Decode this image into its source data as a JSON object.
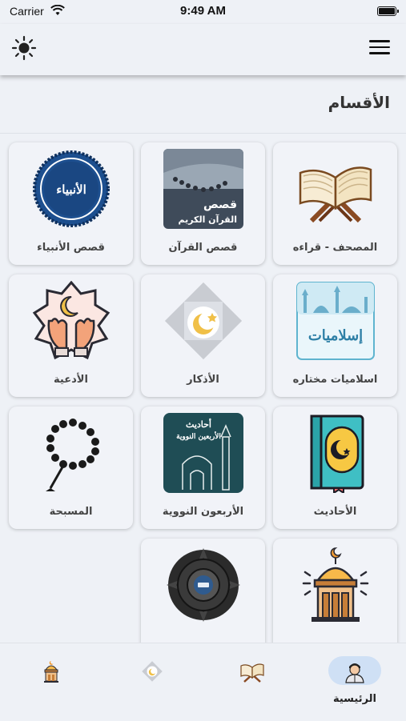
{
  "status_bar": {
    "carrier": "Carrier",
    "time": "9:49 AM"
  },
  "section": {
    "title": "الأقسام"
  },
  "cards": [
    {
      "label": "المصحف - قراءه"
    },
    {
      "label": "قصص القرآن",
      "image_text_1": "قصص",
      "image_text_2": "القرآن الكريم"
    },
    {
      "label": "قصص الأنبياء",
      "image_text": "الأنبياء"
    },
    {
      "label": "اسلاميات مختاره",
      "image_text": "إسلاميات"
    },
    {
      "label": "الأذكار"
    },
    {
      "label": "الأدعية"
    },
    {
      "label": "الأحاديث"
    },
    {
      "label": "الأربعون النووية",
      "image_text_1": "أحاديث",
      "image_text_2": "الأربعين النووية"
    },
    {
      "label": "المسبحة"
    },
    {
      "label": ""
    },
    {
      "label": ""
    }
  ],
  "bottom_nav": {
    "home_label": "الرئيسية"
  },
  "colors": {
    "background": "#eef1f6",
    "card": "#f1f3f8",
    "nav_active": "#cfe0f5",
    "accent_blue": "#1d4f8f",
    "teal": "#1f4d55"
  }
}
